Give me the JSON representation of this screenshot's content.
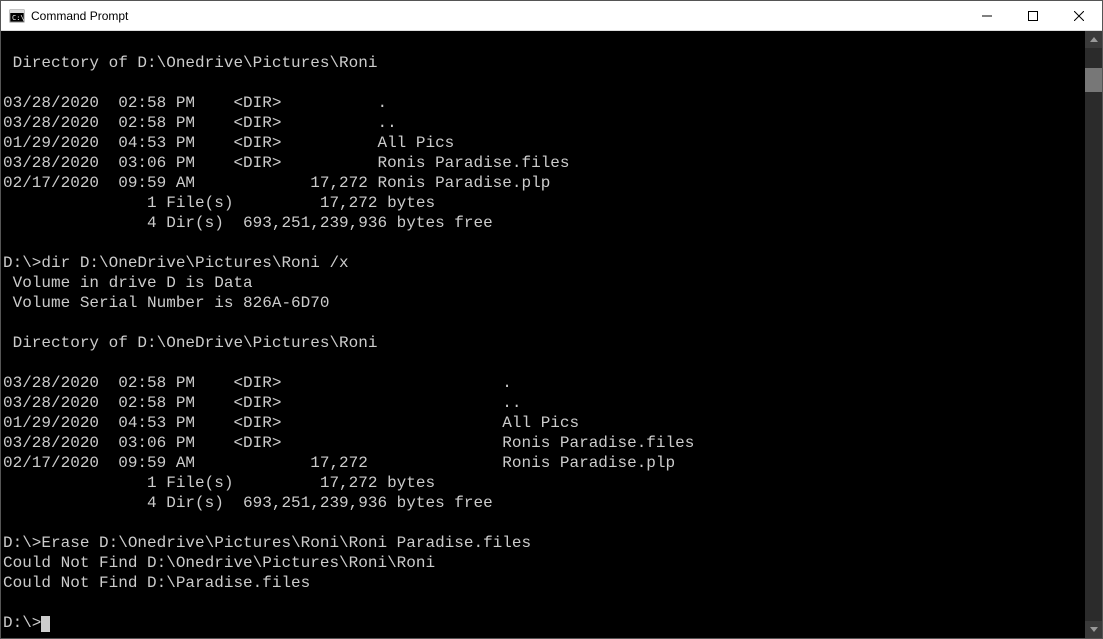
{
  "window": {
    "title": "Command Prompt"
  },
  "console": {
    "lines": [
      "",
      " Directory of D:\\Onedrive\\Pictures\\Roni",
      "",
      "03/28/2020  02:58 PM    <DIR>          .",
      "03/28/2020  02:58 PM    <DIR>          ..",
      "01/29/2020  04:53 PM    <DIR>          All Pics",
      "03/28/2020  03:06 PM    <DIR>          Ronis Paradise.files",
      "02/17/2020  09:59 AM            17,272 Ronis Paradise.plp",
      "               1 File(s)         17,272 bytes",
      "               4 Dir(s)  693,251,239,936 bytes free",
      "",
      "D:\\>dir D:\\OneDrive\\Pictures\\Roni /x",
      " Volume in drive D is Data",
      " Volume Serial Number is 826A-6D70",
      "",
      " Directory of D:\\OneDrive\\Pictures\\Roni",
      "",
      "03/28/2020  02:58 PM    <DIR>                       .",
      "03/28/2020  02:58 PM    <DIR>                       ..",
      "01/29/2020  04:53 PM    <DIR>                       All Pics",
      "03/28/2020  03:06 PM    <DIR>                       Ronis Paradise.files",
      "02/17/2020  09:59 AM            17,272              Ronis Paradise.plp",
      "               1 File(s)         17,272 bytes",
      "               4 Dir(s)  693,251,239,936 bytes free",
      "",
      "D:\\>Erase D:\\Onedrive\\Pictures\\Roni\\Roni Paradise.files",
      "Could Not Find D:\\Onedrive\\Pictures\\Roni\\Roni",
      "Could Not Find D:\\Paradise.files",
      "",
      "D:\\>"
    ]
  }
}
